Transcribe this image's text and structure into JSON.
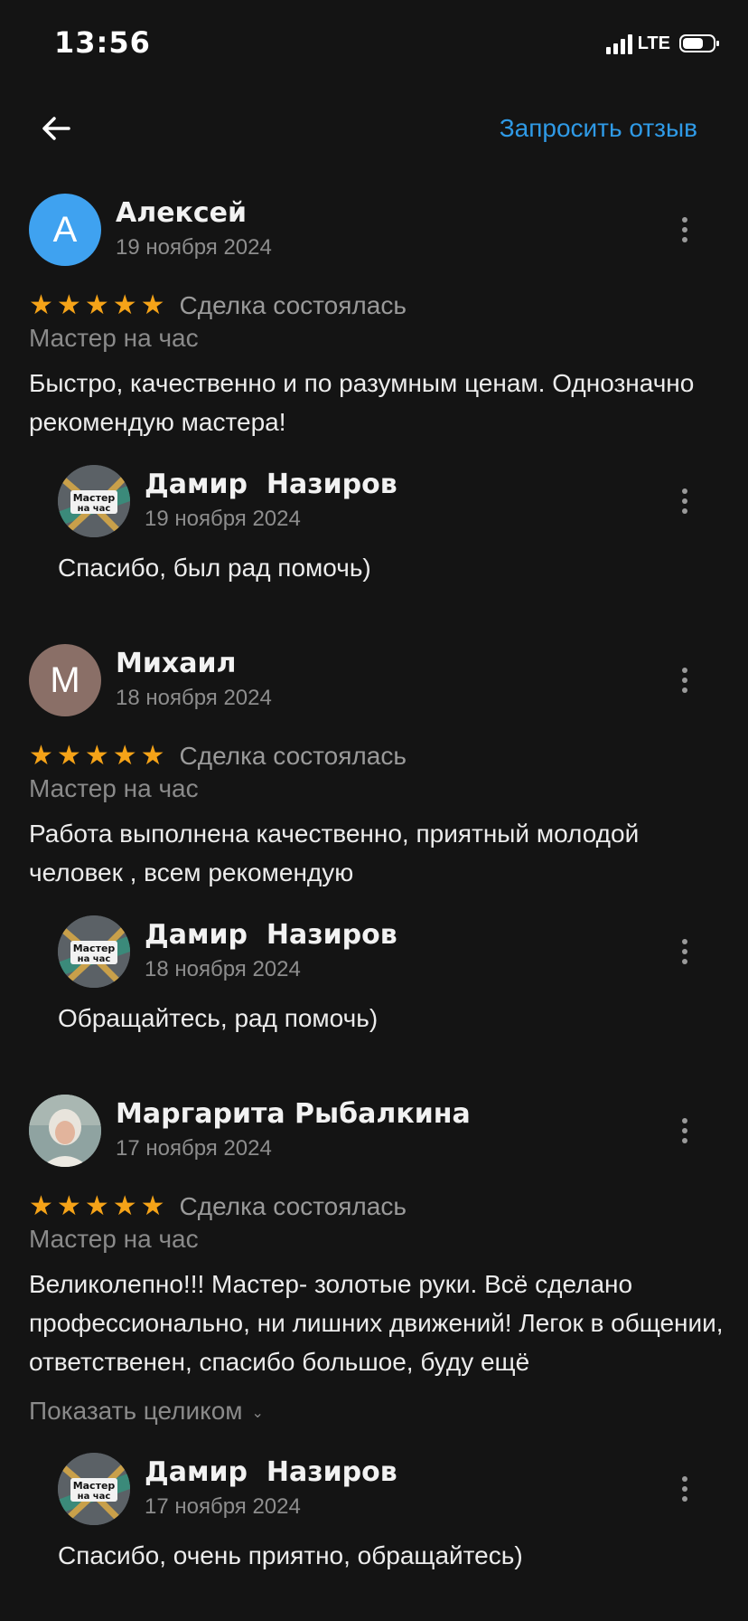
{
  "status_bar": {
    "time": "13:56",
    "network": "LTE"
  },
  "header": {
    "request_review_label": "Запросить отзыв",
    "back_icon": "arrow-left-icon"
  },
  "colors": {
    "accent": "#2f9ae6",
    "star": "#f5a318",
    "background": "#141414"
  },
  "reviews": [
    {
      "avatar_letter": "А",
      "avatar_color": "#3fa2f0",
      "name": "Алексей",
      "date": "19 ноября 2024",
      "rating": 5,
      "deal_status": "Сделка состоялась",
      "category": "Мастер на час",
      "text": "Быстро, качественно и по разумным ценам. Однозначно рекомендую мастера!",
      "reply": {
        "name": "Дамир  Назиров",
        "date": "19 ноября 2024",
        "text": "Спасибо, был рад помочь)",
        "logo_text": [
          "Мастер",
          "на час"
        ]
      }
    },
    {
      "avatar_letter": "М",
      "avatar_color": "#8a6f67",
      "name": "Михаил",
      "date": "18 ноября 2024",
      "rating": 5,
      "deal_status": "Сделка состоялась",
      "category": "Мастер на час",
      "text": "Работа выполнена качественно, приятный молодой человек , всем рекомендую",
      "reply": {
        "name": "Дамир  Назиров",
        "date": "18 ноября 2024",
        "text": "Обращайтесь, рад помочь)",
        "logo_text": [
          "Мастер",
          "на час"
        ]
      }
    },
    {
      "avatar_letter": "",
      "avatar_color": "#7d8a86",
      "name": "Маргарита Рыбалкина",
      "date": "17 ноября 2024",
      "rating": 5,
      "deal_status": "Сделка состоялась",
      "category": "Мастер на час",
      "text": "Великолепно!!! Мастер- золотые руки. Всё сделано профессионально, ни лишних движений! Легок в общении, ответственен, спасибо большое, буду ещё",
      "show_more_label": "Показать целиком",
      "reply": {
        "name": "Дамир  Назиров",
        "date": "17 ноября 2024",
        "text": "Спасибо, очень приятно, обращайтесь)",
        "logo_text": [
          "Мастер",
          "на час"
        ]
      }
    }
  ]
}
